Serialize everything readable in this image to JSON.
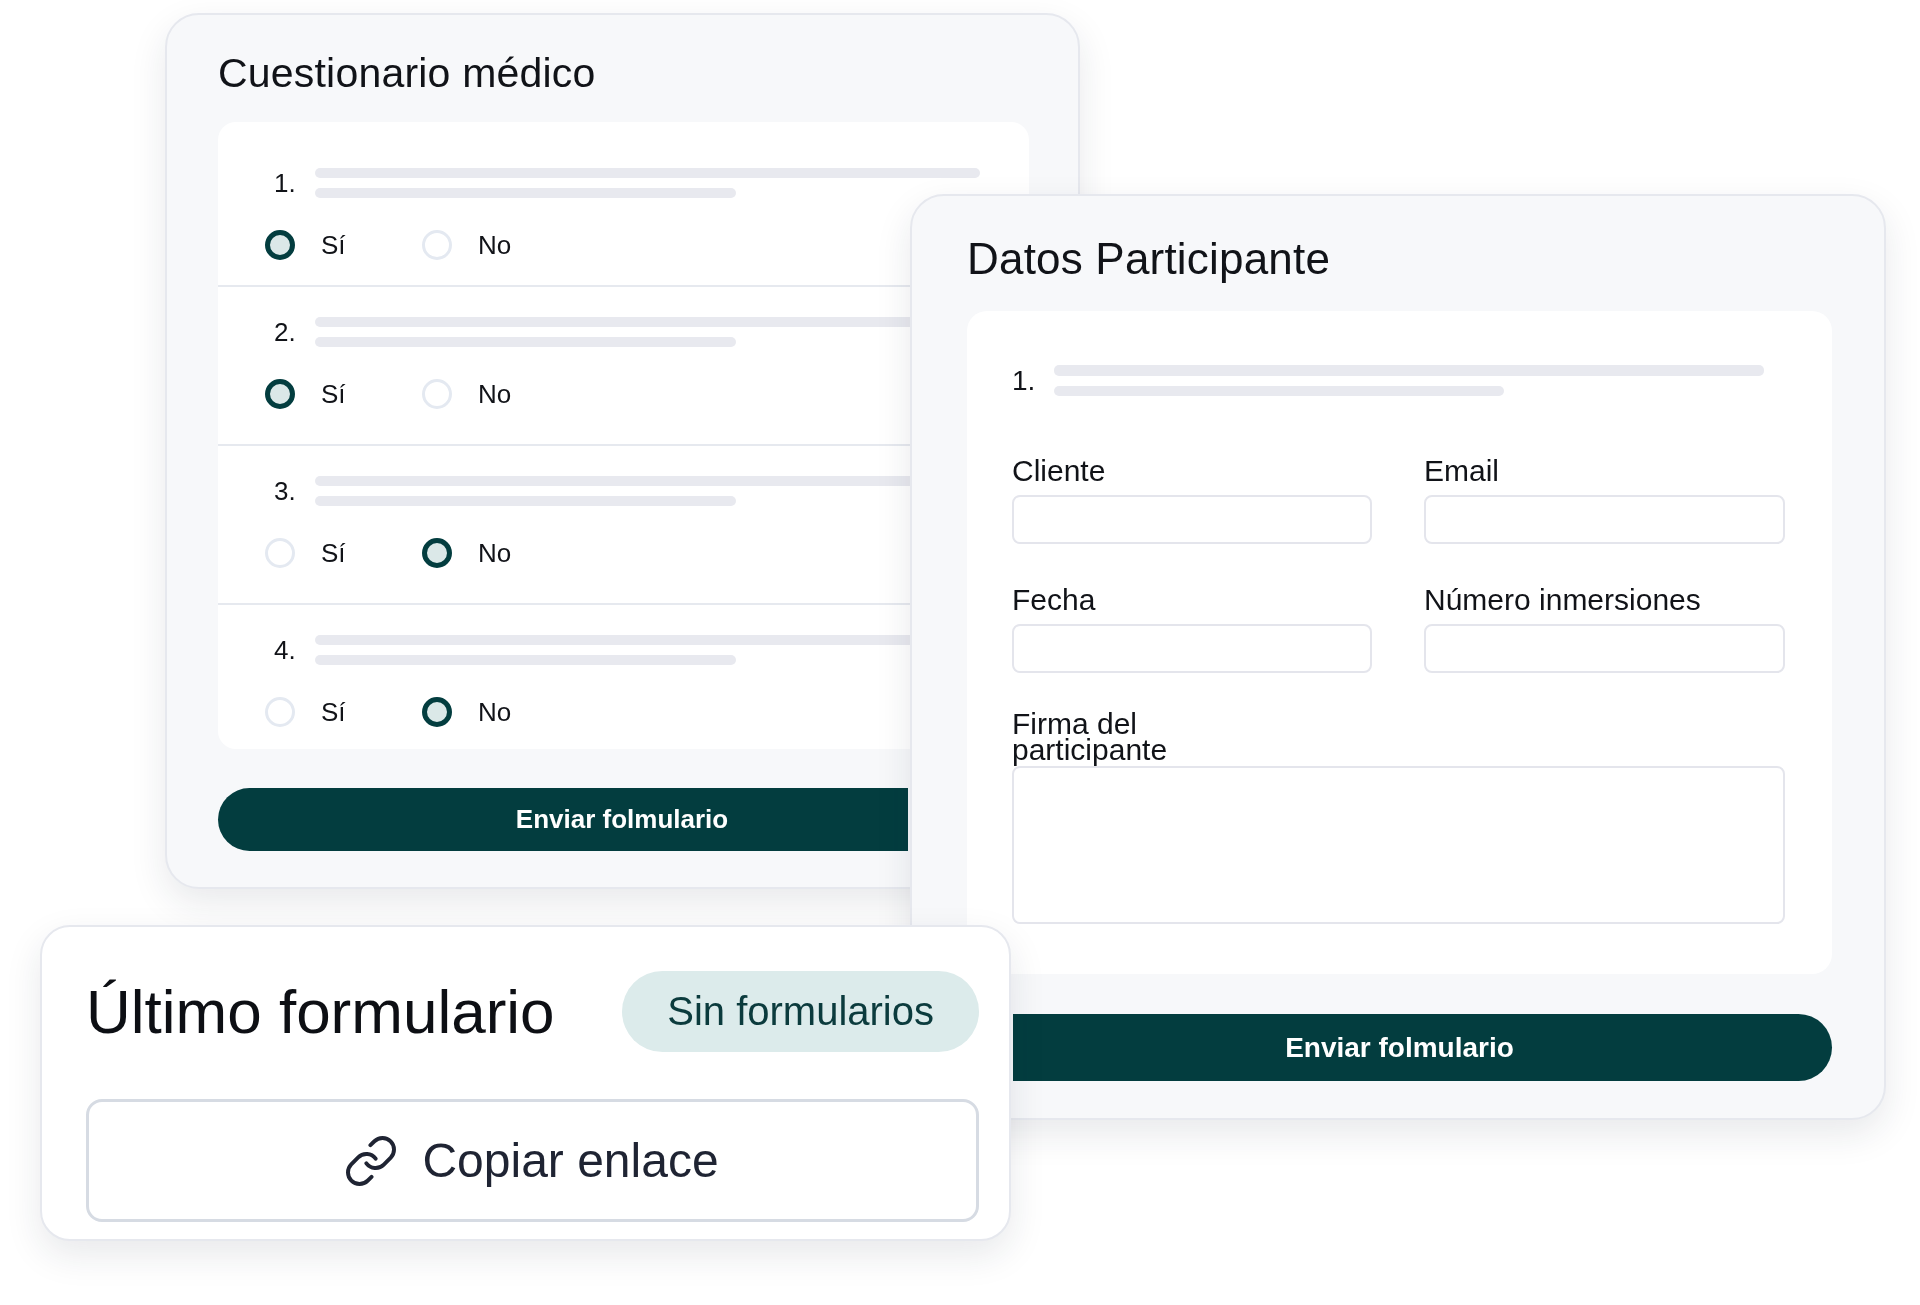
{
  "questionnaire": {
    "title": "Cuestionario médico",
    "questions": [
      {
        "number": "1.",
        "options": [
          {
            "label": "Sí",
            "selected": true
          },
          {
            "label": "No",
            "selected": false
          }
        ]
      },
      {
        "number": "2.",
        "options": [
          {
            "label": "Sí",
            "selected": true
          },
          {
            "label": "No",
            "selected": false
          }
        ]
      },
      {
        "number": "3.",
        "options": [
          {
            "label": "Sí",
            "selected": false
          },
          {
            "label": "No",
            "selected": true
          }
        ]
      },
      {
        "number": "4.",
        "options": [
          {
            "label": "Sí",
            "selected": false
          },
          {
            "label": "No",
            "selected": true
          }
        ]
      }
    ],
    "submit_button": "Enviar folmulario"
  },
  "participant_form": {
    "title": "Datos Participante",
    "question_number": "1.",
    "fields": [
      {
        "kind": "text",
        "label": "Cliente"
      },
      {
        "kind": "text",
        "label": "Email"
      },
      {
        "kind": "text",
        "label": "Fecha"
      },
      {
        "kind": "text",
        "label": "Número inmersiones"
      },
      {
        "kind": "signature",
        "label": "Firma del participante"
      }
    ],
    "submit_button": "Enviar folmulario"
  },
  "last_form_card": {
    "title": "Último formulario",
    "badge": "Sin formularios",
    "copy_link_button": "Copiar enlace"
  }
}
